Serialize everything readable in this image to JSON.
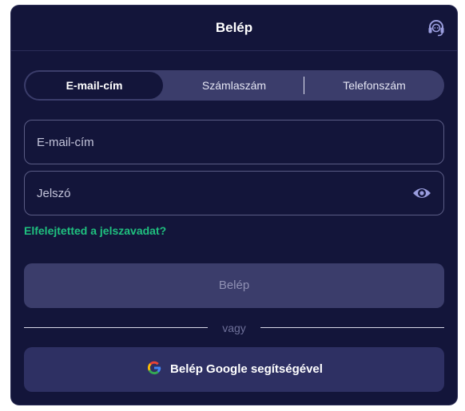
{
  "header": {
    "title": "Belép",
    "support_icon": "headset-icon"
  },
  "tabs": [
    {
      "label": "E-mail-cím",
      "active": true
    },
    {
      "label": "Számlaszám",
      "active": false
    },
    {
      "label": "Telefonszám",
      "active": false
    }
  ],
  "form": {
    "email": {
      "placeholder": "E-mail-cím",
      "value": ""
    },
    "password": {
      "placeholder": "Jelszó",
      "value": "",
      "toggle_icon": "eye-icon"
    },
    "forgot_label": "Elfelejtetted a jelszavadat?",
    "login_label": "Belép"
  },
  "divider": {
    "label": "vagy"
  },
  "google": {
    "label": "Belép Google segítségével",
    "icon": "google-icon"
  },
  "colors": {
    "background": "#13153a",
    "tab_track": "#3b3d6b",
    "accent_green": "#1fc07f",
    "google_button": "#2e3063"
  }
}
